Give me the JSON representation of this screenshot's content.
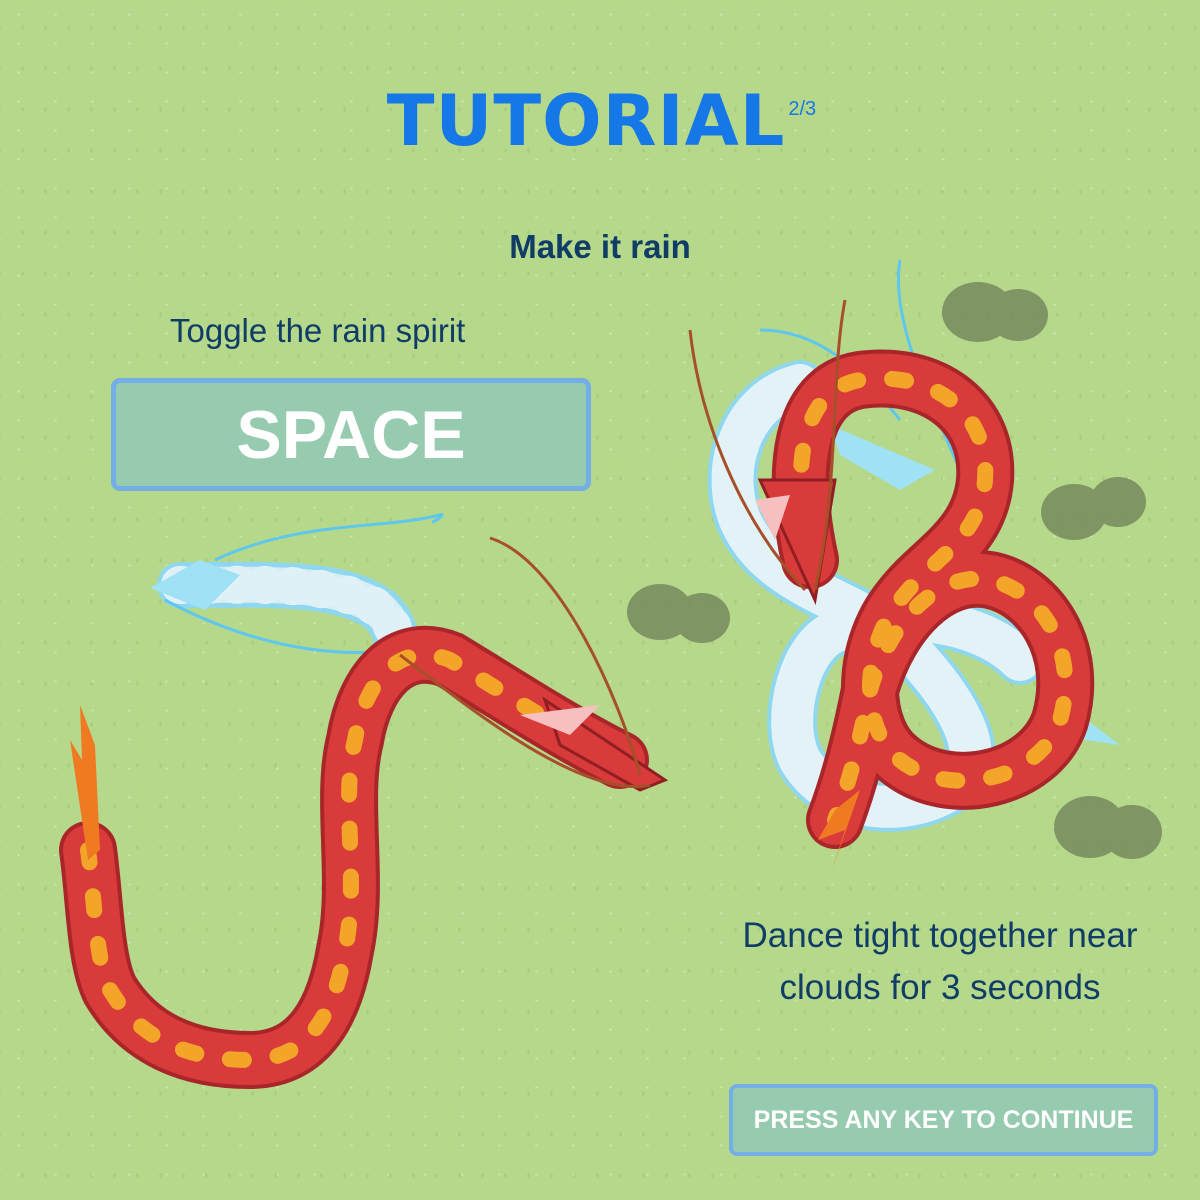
{
  "header": {
    "title": "TUTORIAL",
    "page_indicator": "2/3",
    "subtitle": "Make it rain"
  },
  "instructions": {
    "toggle_hint": "Toggle the rain spirit",
    "key_label": "SPACE",
    "goal_line_1": "Dance tight together near",
    "goal_line_2": "clouds for 3 seconds"
  },
  "footer": {
    "continue_label": "PRESS ANY KEY TO CONTINUE"
  },
  "colors": {
    "background": "#b6d88b",
    "title_blue": "#1677e6",
    "text_navy": "#0f3d66",
    "key_fill": "#97cbb0",
    "key_border": "#74aee6",
    "fire_dragon": "#d43030",
    "water_dragon": "#d7ecf5",
    "cloud": "#6e7f58"
  },
  "sprites": [
    "fire-dragon",
    "water-dragon",
    "rain-cloud"
  ]
}
